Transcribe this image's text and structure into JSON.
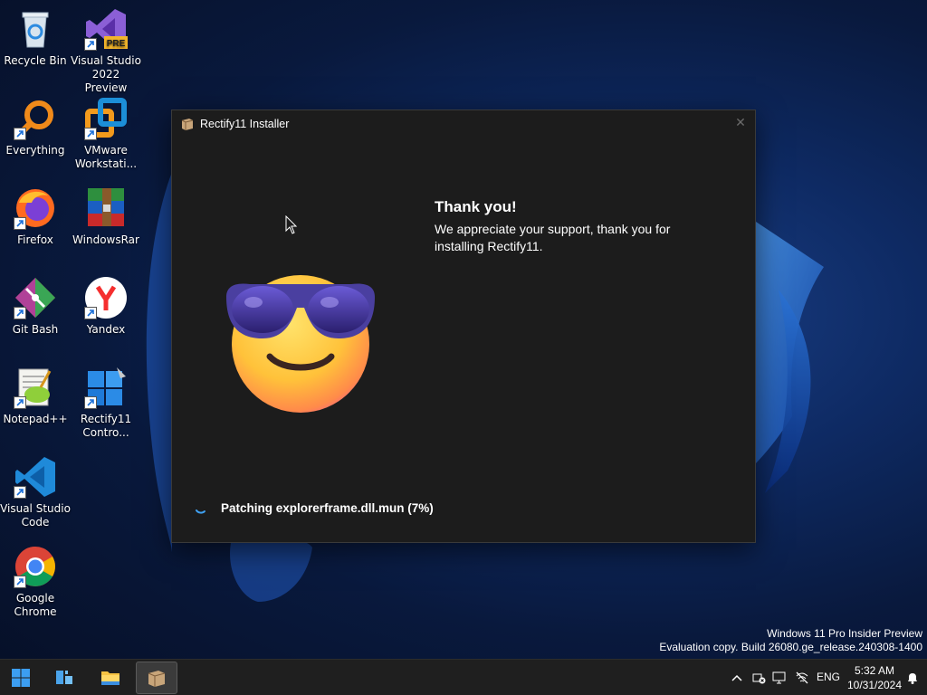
{
  "desktop": {
    "icons": [
      {
        "label": "Recycle Bin",
        "icon": "recycle-bin-icon"
      },
      {
        "label": "Visual Studio 2022 Preview",
        "icon": "visual-studio-preview-icon",
        "badge": "PRE"
      },
      {
        "label": "Everything",
        "icon": "everything-search-icon"
      },
      {
        "label": "VMware Workstati...",
        "icon": "vmware-icon"
      },
      {
        "label": "Firefox",
        "icon": "firefox-icon"
      },
      {
        "label": "WindowsRar",
        "icon": "winrar-icon"
      },
      {
        "label": "Git Bash",
        "icon": "git-bash-icon"
      },
      {
        "label": "Yandex",
        "icon": "yandex-icon"
      },
      {
        "label": "Notepad++",
        "icon": "notepadpp-icon"
      },
      {
        "label": "Rectify11 Contro...",
        "icon": "rectify11-control-icon"
      },
      {
        "label": "Visual Studio Code",
        "icon": "vscode-icon"
      },
      {
        "label": "Google Chrome",
        "icon": "chrome-icon"
      }
    ]
  },
  "installer": {
    "title": "Rectify11 Installer",
    "heading": "Thank you!",
    "message": "We appreciate your support, thank you for installing Rectify11.",
    "status": "Patching explorerframe.dll.mun (7%)",
    "progress_percent": 7
  },
  "watermark": {
    "line1": "Windows 11 Pro Insider Preview",
    "line2": "Evaluation copy. Build 26080.ge_release.240308-1400"
  },
  "taskbar": {
    "language": "ENG",
    "time": "5:32 AM",
    "date": "10/31/2024"
  },
  "colors": {
    "accent": "#0078d4",
    "window_bg": "#1c1c1c",
    "taskbar_bg": "#1f1f1f"
  }
}
